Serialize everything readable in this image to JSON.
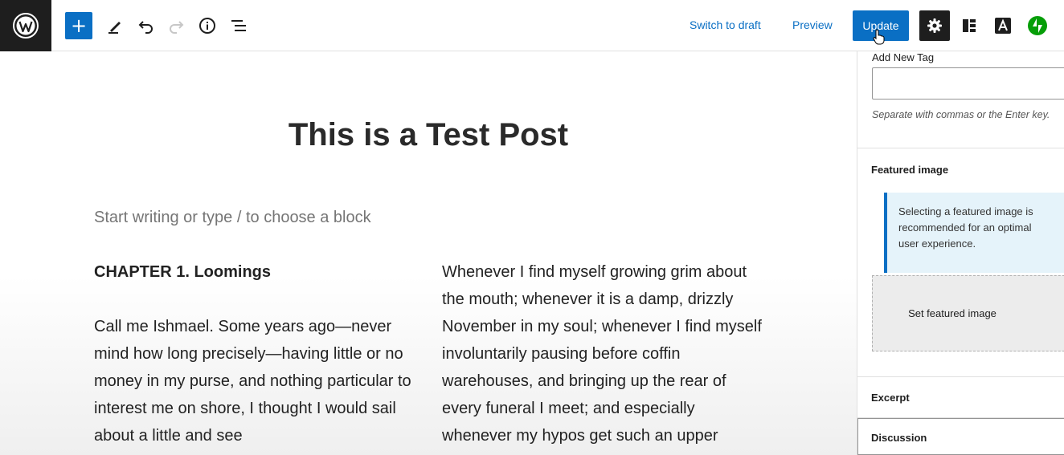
{
  "toolbar": {
    "switch_to_draft": "Switch to draft",
    "preview": "Preview",
    "update": "Update",
    "add_block_symbol": "+"
  },
  "editor": {
    "title": "This is a Test Post",
    "placeholder": "Start writing or type / to choose a block",
    "left_column": {
      "heading": "CHAPTER 1. Loomings",
      "paragraph": "Call me Ishmael. Some years ago—never mind how long precisely—having little or no money in my purse, and nothing particular to interest me on shore, I thought I would sail about a little and see"
    },
    "right_column": {
      "paragraph": "Whenever I find myself growing grim about the mouth; whenever it is a damp, drizzly November in my soul; whenever I find myself involuntarily pausing before coffin warehouses, and bringing up the rear of every funeral I meet; and especially whenever my hypos get such an upper"
    }
  },
  "sidebar": {
    "tags": {
      "label": "Add New Tag",
      "input_value": "",
      "help": "Separate with commas or the Enter key."
    },
    "featured_image": {
      "title": "Featured image",
      "notice": "Selecting a featured image is recommended for an optimal user experience.",
      "button": "Set featured image"
    },
    "excerpt": {
      "title": "Excerpt"
    },
    "discussion": {
      "title": "Discussion"
    }
  },
  "colors": {
    "accent": "#0a6fc4",
    "dark": "#1e1e1e",
    "jetpack": "#069e08"
  }
}
